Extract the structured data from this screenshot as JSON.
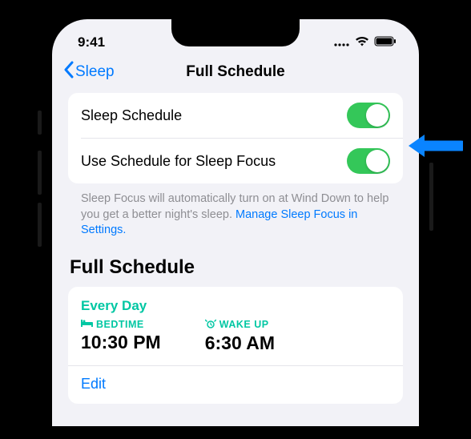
{
  "status": {
    "time": "9:41"
  },
  "nav": {
    "back_label": "Sleep",
    "title": "Full Schedule"
  },
  "toggles": {
    "sleep_schedule": {
      "label": "Sleep Schedule",
      "on": true
    },
    "use_focus": {
      "label": "Use Schedule for Sleep Focus",
      "on": true
    }
  },
  "footer": {
    "text": "Sleep Focus will automatically turn on at Wind Down to help you get a better night's sleep. ",
    "link": "Manage Sleep Focus in Settings."
  },
  "section": {
    "title": "Full Schedule"
  },
  "schedule": {
    "days": "Every Day",
    "bedtime": {
      "label": "BEDTIME",
      "value": "10:30 PM"
    },
    "wakeup": {
      "label": "WAKE UP",
      "value": "6:30 AM"
    },
    "edit": "Edit"
  }
}
